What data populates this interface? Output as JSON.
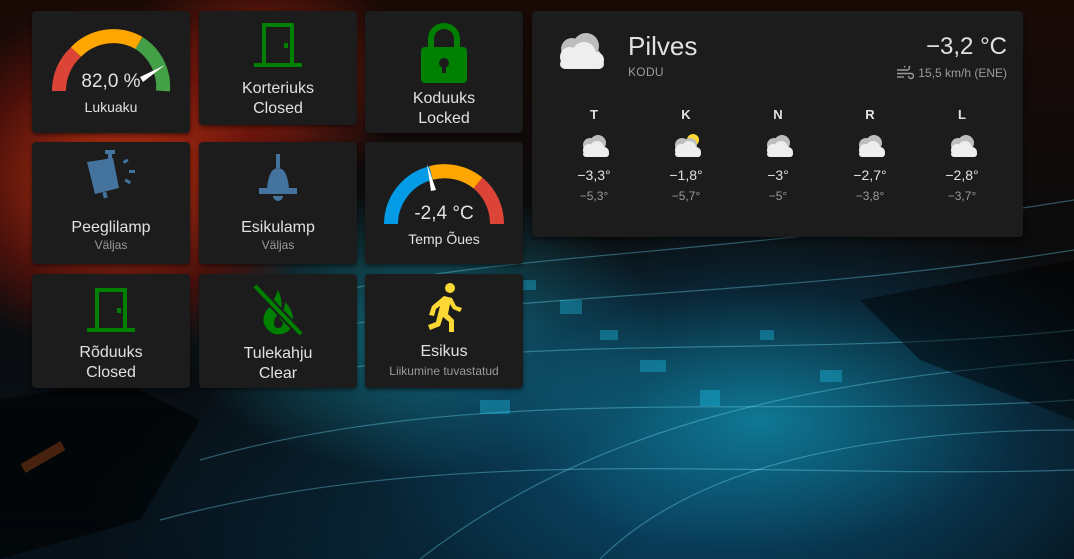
{
  "colors": {
    "card_bg": "#1c1c1c",
    "green": "#008000",
    "blue_icon": "#44739e",
    "yellow": "#fdd835",
    "gauge_red": "#db4437",
    "gauge_orange": "#ffa600",
    "gauge_green": "#43a047",
    "gauge_blue": "#039be5"
  },
  "tiles": {
    "lukuaku": {
      "value": "82,0 %",
      "name": "Lukuaku",
      "level_percent": 82
    },
    "korteriuks": {
      "name": "Korteriuks",
      "state": "Closed",
      "icon": "door-closed-icon"
    },
    "koduuks": {
      "name": "Koduuks",
      "state": "Locked",
      "icon": "lock-icon"
    },
    "peeglilamp": {
      "name": "Peeglilamp",
      "state": "Väljas",
      "icon": "wall-lamp-icon"
    },
    "esikulamp": {
      "name": "Esikulamp",
      "state": "Väljas",
      "icon": "ceiling-light-icon"
    },
    "temp_oues": {
      "value": "-2,4 °C",
      "name": "Temp Õues"
    },
    "roduuks": {
      "name": "Rõduuks",
      "state": "Closed",
      "icon": "door-closed-icon"
    },
    "tulekahju": {
      "name": "Tulekahju",
      "state": "Clear",
      "icon": "fire-off-icon"
    },
    "esikus": {
      "name": "Esikus",
      "state": "Liikumine tuvastatud",
      "icon": "motion-walk-icon"
    }
  },
  "weather": {
    "condition": "Pilves",
    "location": "KODU",
    "temperature": "−3,2 °C",
    "wind": "15,5 km/h (ENE)",
    "icon": "cloudy-icon",
    "forecast": [
      {
        "day": "T",
        "high": "−3,3°",
        "low": "−5,3°",
        "icon": "cloudy-icon"
      },
      {
        "day": "K",
        "high": "−1,8°",
        "low": "−5,7°",
        "icon": "partly-cloudy-icon"
      },
      {
        "day": "N",
        "high": "−3°",
        "low": "−5°",
        "icon": "cloudy-icon"
      },
      {
        "day": "R",
        "high": "−2,7°",
        "low": "−3,8°",
        "icon": "cloudy-icon"
      },
      {
        "day": "L",
        "high": "−2,8°",
        "low": "−3,7°",
        "icon": "cloudy-icon"
      }
    ]
  }
}
